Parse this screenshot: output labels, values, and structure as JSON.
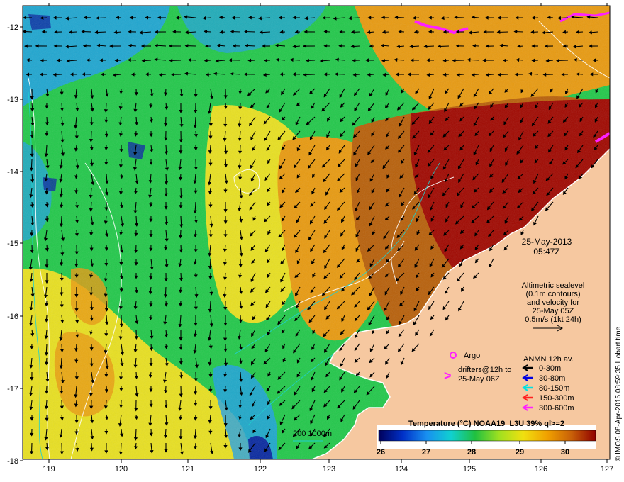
{
  "map": {
    "lat_ticks": [
      "-12",
      "-13",
      "-14",
      "-15",
      "-16",
      "-17",
      "-18"
    ],
    "lon_ticks": [
      "119",
      "120",
      "121",
      "122",
      "123",
      "124",
      "125",
      "126",
      "127"
    ],
    "land_color": "#f6c8a0",
    "coastline_color": "#ffffff",
    "colors": {
      "cold": "#0a2aa0",
      "cool": "#1fa0e8",
      "mid": "#22c84a",
      "warm_yellow": "#e8e020",
      "orange": "#e89a10",
      "brown": "#b8600a",
      "hot": "#a00800"
    }
  },
  "overlay": {
    "date": "25-May-2013",
    "time": "05:47Z",
    "altimetry_note": [
      "Altimetric sealevel",
      "(0.1m contours)",
      "and velocity for",
      "25-May 05Z",
      "0.5m/s (1kt 24h)"
    ],
    "argo_label": "Argo",
    "drifters_label": [
      "drifters@12h to",
      "25-May 06Z"
    ],
    "anmn_title": "ANMN 12h av.",
    "anmn_items": [
      {
        "label": "0-30m",
        "color": "#000000"
      },
      {
        "label": "30-80m",
        "color": "#0000e0"
      },
      {
        "label": "80-150m",
        "color": "#00e0e0"
      },
      {
        "label": "150-300m",
        "color": "#ff2020"
      },
      {
        "label": "300-600m",
        "color": "#ff20ff"
      }
    ],
    "isobath_label": "200  1000m"
  },
  "colorbar": {
    "title": "Temperature (°C) NOAA19_L3U 39% ql>=2",
    "ticks": [
      "26",
      "27",
      "28",
      "29",
      "30"
    ],
    "stops": [
      "#00005a",
      "#0030c8",
      "#1890f0",
      "#10d0d0",
      "#20c040",
      "#a0e020",
      "#f0e010",
      "#f0a000",
      "#c86008",
      "#900000"
    ]
  },
  "credit": "© IMOS 08-Apr-2015 08:59:35 Hobart time"
}
